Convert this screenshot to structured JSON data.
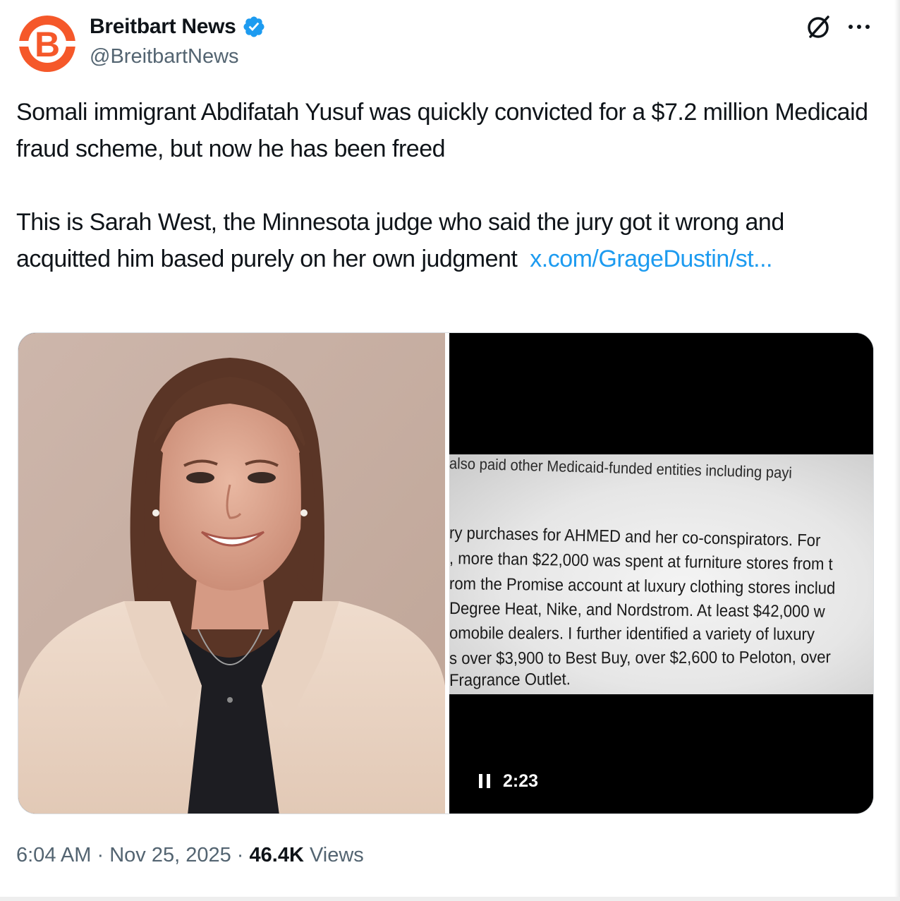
{
  "account": {
    "name": "Breitbart News",
    "handle": "@BreitbartNews",
    "avatar_letter": "B",
    "brand_color": "#f5582a",
    "verified": true,
    "verified_color": "#1d9bf0"
  },
  "header": {
    "grok_icon": "grok-slash-circle-icon",
    "more_icon": "more-horizontal-icon"
  },
  "tweet": {
    "paragraph_1": "Somali immigrant Abdifatah Yusuf was quickly convicted for a $7.2 million Medicaid fraud scheme, but now he has been freed",
    "paragraph_2": "This is Sarah West, the Minnesota judge who said the jury got it wrong and acquitted him based purely on her own judgment",
    "link_text": "x.com/​GrageDustin/st..."
  },
  "media": {
    "video": {
      "time": "2:23",
      "lines": [
        "also paid other Medicaid-funded entities including payi",
        "ry purchases for AHMED and her co-conspirators. For",
        ", more than $22,000 was spent at furniture stores from t",
        "rom the Promise account at luxury clothing stores includ",
        "Degree Heat, Nike, and Nordstrom. At least $42,000 w",
        "omobile dealers. I further identified a variety of luxury",
        "s over $3,900 to Best Buy, over $2,600 to Peloton, over",
        "Fragrance Outlet."
      ]
    }
  },
  "footer": {
    "time": "6:04 AM",
    "separator": "·",
    "date": "Nov 25, 2025",
    "views_count": "46.4K",
    "views_label": "Views"
  }
}
